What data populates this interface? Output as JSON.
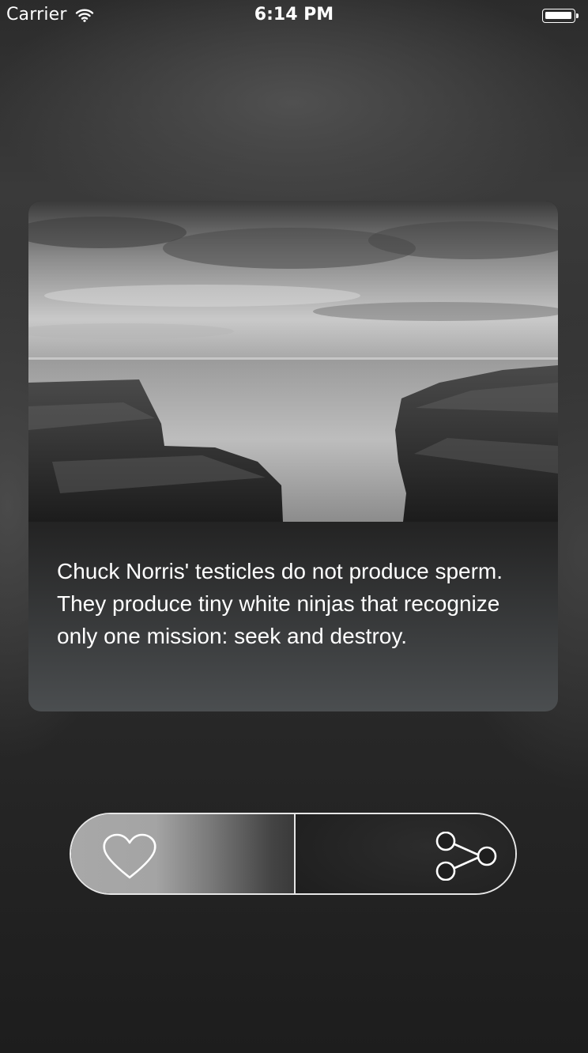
{
  "status_bar": {
    "carrier": "Carrier",
    "time": "6:14 PM",
    "wifi_icon": "wifi-icon",
    "battery_icon": "battery-icon"
  },
  "card": {
    "photo": "black-and-white seascape with rocky cliffs",
    "text": "Chuck Norris' testicles do not produce sperm. They produce tiny white ninjas that recognize only one mission: seek and destroy."
  },
  "actions": {
    "like_icon": "heart-icon",
    "share_icon": "share-icon"
  },
  "colors": {
    "background": "#2a2a2a",
    "card_text_area": "#1d1d1d",
    "pill_border": "#e6e6e6",
    "text": "#ffffff"
  }
}
